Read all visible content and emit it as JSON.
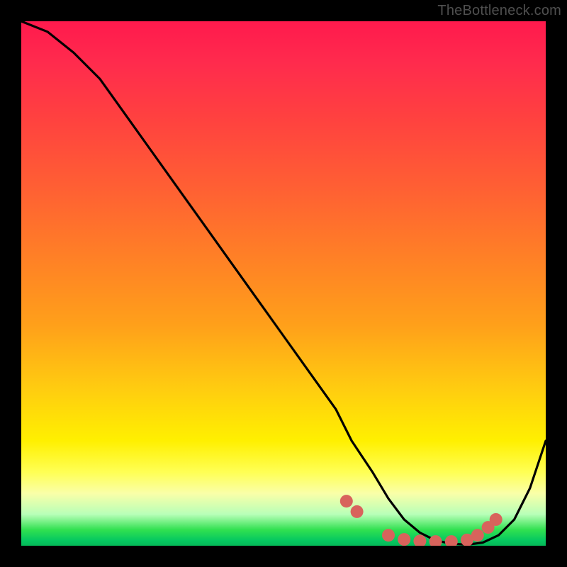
{
  "watermark": "TheBottleneck.com",
  "chart_data": {
    "type": "line",
    "title": "",
    "xlabel": "",
    "ylabel": "",
    "xlim": [
      0,
      100
    ],
    "ylim": [
      0,
      100
    ],
    "series": [
      {
        "name": "bottleneck-curve",
        "x": [
          0,
          5,
          10,
          15,
          20,
          25,
          30,
          35,
          40,
          45,
          50,
          55,
          60,
          63,
          67,
          70,
          73,
          76,
          79,
          82,
          85,
          88,
          91,
          94,
          97,
          100
        ],
        "y": [
          100,
          98,
          94,
          89,
          82,
          75,
          68,
          61,
          54,
          47,
          40,
          33,
          26,
          20,
          14,
          9,
          5,
          2.5,
          1,
          0.4,
          0.2,
          0.6,
          2,
          5,
          11,
          20
        ]
      }
    ],
    "markers": {
      "name": "highlight-dots",
      "color": "#d8635c",
      "points": [
        {
          "x": 62,
          "y": 8.5
        },
        {
          "x": 64,
          "y": 6.5
        },
        {
          "x": 70,
          "y": 2.0
        },
        {
          "x": 73,
          "y": 1.2
        },
        {
          "x": 76,
          "y": 0.9
        },
        {
          "x": 79,
          "y": 0.8
        },
        {
          "x": 82,
          "y": 0.8
        },
        {
          "x": 85,
          "y": 1.1
        },
        {
          "x": 87,
          "y": 2.0
        },
        {
          "x": 89,
          "y": 3.5
        },
        {
          "x": 90.5,
          "y": 5.0
        }
      ]
    }
  }
}
